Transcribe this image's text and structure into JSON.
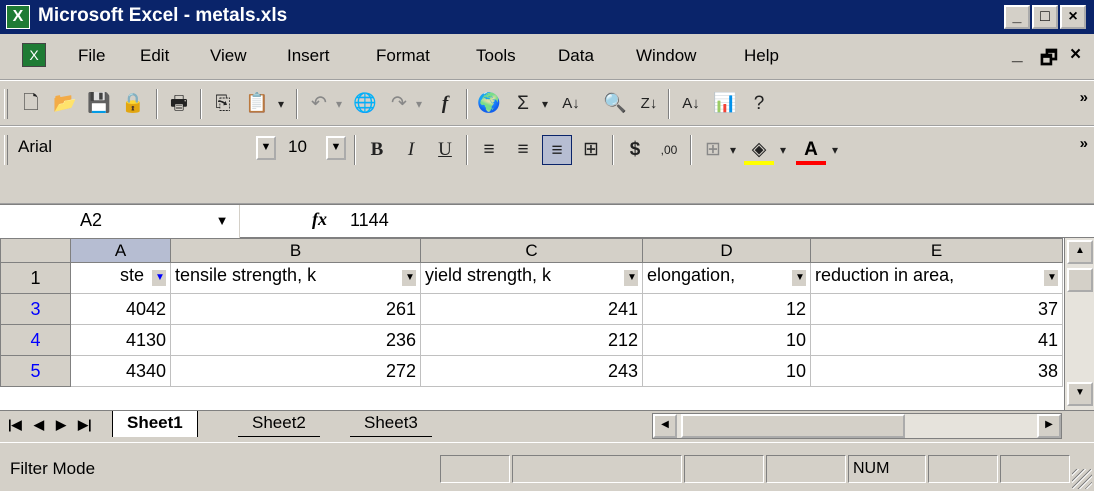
{
  "window": {
    "title": "Microsoft Excel - metals.xls",
    "controls": {
      "minimize": "_",
      "restore": "□",
      "close": "×"
    }
  },
  "menu": {
    "items": [
      "File",
      "Edit",
      "View",
      "Insert",
      "Format",
      "Tools",
      "Data",
      "Window",
      "Help"
    ],
    "doc_controls": {
      "minimize": "_",
      "restore": "🗗",
      "close": "×"
    }
  },
  "toolbar_standard": {
    "buttons": [
      "new-icon",
      "open-icon",
      "save-icon",
      "permission-icon",
      "print-icon",
      "copy-icon",
      "paste-icon",
      "undo-icon",
      "hyperlink-icon",
      "redo-icon",
      "insert-function-icon",
      "web-icon",
      "autosum-icon",
      "sort-ascending-icon",
      "research-icon",
      "sort-descending-icon",
      "sort-ascending-2-icon",
      "chart-wizard-icon",
      "help-icon"
    ],
    "more": "»"
  },
  "toolbar_format": {
    "font": "Arial",
    "size": "10",
    "bold": "B",
    "italic": "I",
    "underline": "U",
    "currency": "$",
    "decimal": ",00",
    "more": "»"
  },
  "formula_bar": {
    "name_box": "A2",
    "fx": "fx",
    "value": "1144"
  },
  "sheet": {
    "columns": [
      "A",
      "B",
      "C",
      "D",
      "E"
    ],
    "header_row": {
      "num": "1",
      "cells": [
        "ste",
        "tensile strength, k",
        "yield strength, k",
        "elongation,",
        "reduction in area,"
      ]
    },
    "rows": [
      {
        "num": "3",
        "cells": [
          "4042",
          "261",
          "241",
          "12",
          "37"
        ]
      },
      {
        "num": "4",
        "cells": [
          "4130",
          "236",
          "212",
          "10",
          "41"
        ]
      },
      {
        "num": "5",
        "cells": [
          "4340",
          "272",
          "243",
          "10",
          "38"
        ]
      }
    ]
  },
  "tabs": {
    "sheets": [
      "Sheet1",
      "Sheet2",
      "Sheet3"
    ],
    "active": "Sheet1"
  },
  "status": {
    "message": "Filter Mode",
    "num": "NUM"
  },
  "colors": {
    "title_bg": "#0a246a",
    "chrome": "#d4d0c8",
    "filtered_row": "#0000ff"
  }
}
